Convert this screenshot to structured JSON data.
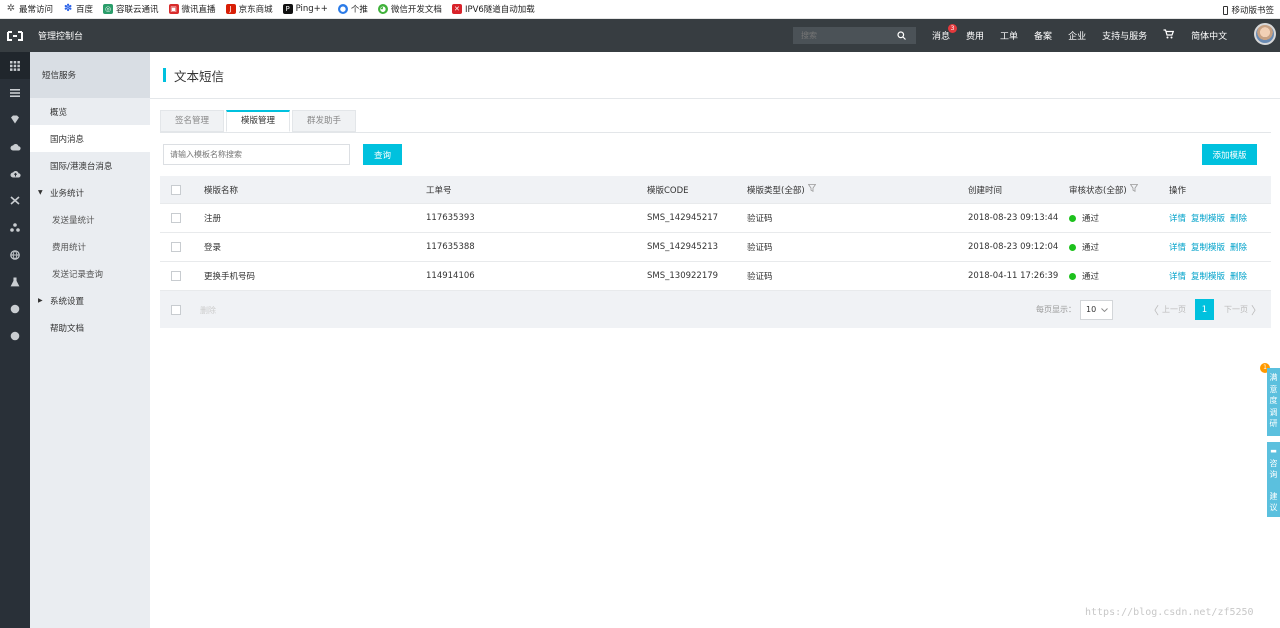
{
  "bookmarks": [
    {
      "label": "最常访问",
      "icon": "gear-icon",
      "color": "#555555"
    },
    {
      "label": "百度",
      "icon": "baidu-paw-icon",
      "color": "#2a62e8"
    },
    {
      "label": "容联云通讯",
      "icon": "ronglian-icon",
      "color": "#2a9d6a"
    },
    {
      "label": "微讯直播",
      "icon": "live-icon",
      "color": "#d82b2b"
    },
    {
      "label": "京东商城",
      "icon": "jd-icon",
      "color": "#d81e06"
    },
    {
      "label": "Ping++",
      "icon": "pingpp-icon",
      "color": "#111111"
    },
    {
      "label": "个推",
      "icon": "getui-icon",
      "color": "#2b7be8"
    },
    {
      "label": "微信开发文档",
      "icon": "wechat-icon",
      "color": "#3fb13a"
    },
    {
      "label": "IPV6隧道自动加载",
      "icon": "ipv6-icon",
      "color": "#d8222a"
    }
  ],
  "mobile_bookmarks": "移动版书签",
  "topnav": {
    "console_title": "管理控制台",
    "search_placeholder": "搜索",
    "links": {
      "messages": "消息",
      "messages_badge": "3",
      "fees": "费用",
      "ticket": "工单",
      "filing": "备案",
      "enterprise": "企业",
      "support": "支持与服务",
      "language": "简体中文"
    }
  },
  "submenu": {
    "title": "短信服务",
    "overview": "概览",
    "domestic": "国内消息",
    "international": "国际/港澳台消息",
    "stats_group": "业务统计",
    "stats_send": "发送量统计",
    "stats_fee": "费用统计",
    "stats_records": "发送记录查询",
    "settings_group": "系统设置",
    "help": "帮助文档"
  },
  "page": {
    "title": "文本短信",
    "tabs": [
      "签名管理",
      "模版管理",
      "群发助手"
    ],
    "search_placeholder": "请输入模板名称搜索",
    "query_button": "查询",
    "add_button": "添加模版"
  },
  "table": {
    "headers": {
      "name": "模版名称",
      "ticket": "工单号",
      "code": "模版CODE",
      "type": "模版类型(全部)",
      "created": "创建时间",
      "status": "审核状态(全部)",
      "actions": "操作"
    },
    "rows": [
      {
        "name": "注册",
        "ticket": "117635393",
        "code": "SMS_142945217",
        "type": "验证码",
        "created": "2018-08-23 09:13:44",
        "status": "通过"
      },
      {
        "name": "登录",
        "ticket": "117635388",
        "code": "SMS_142945213",
        "type": "验证码",
        "created": "2018-08-23 09:12:04",
        "status": "通过"
      },
      {
        "name": "更换手机号码",
        "ticket": "114914106",
        "code": "SMS_130922179",
        "type": "验证码",
        "created": "2018-04-11 17:26:39",
        "status": "通过"
      }
    ],
    "action_labels": {
      "detail": "详情",
      "copy": "复制模版",
      "delete": "删除"
    },
    "footer": {
      "delete": "删除",
      "per_page_label": "每页显示：",
      "per_page_value": "10",
      "prev": "上一页",
      "current_page": "1",
      "next": "下一页"
    }
  },
  "float_panel": {
    "survey": [
      "满",
      "意",
      "度",
      "调",
      "研"
    ],
    "feedback_top": [
      "咨",
      "询"
    ],
    "feedback_bottom": [
      "建",
      "议"
    ],
    "badge": "1"
  },
  "watermark": "https://blog.csdn.net/zf5250"
}
